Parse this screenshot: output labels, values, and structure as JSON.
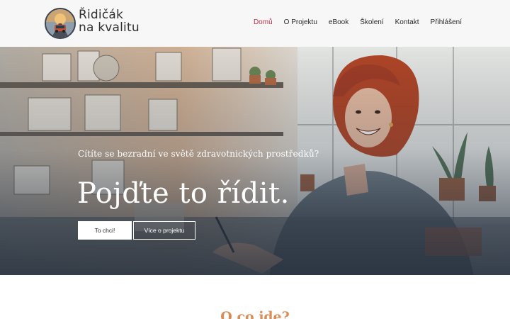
{
  "brand": {
    "line1": "Řidičák",
    "line2": "na kvalitu",
    "logo_icon": "car-road-logo-icon"
  },
  "nav": {
    "items": [
      {
        "label": "Domů",
        "active": true
      },
      {
        "label": "O Projektu",
        "active": false
      },
      {
        "label": "eBook",
        "active": false
      },
      {
        "label": "Školení",
        "active": false
      },
      {
        "label": "Kontakt",
        "active": false
      },
      {
        "label": "Přihlášení",
        "active": false
      }
    ]
  },
  "hero": {
    "subtitle": "Cítíte se bezradní ve světě zdravotnických prostředků?",
    "title": "Pojďte to řídit.",
    "primary_button": "To chci!",
    "secondary_button": "Více o projektu"
  },
  "section": {
    "title": "O co jde?"
  },
  "colors": {
    "accent": "#c0304a",
    "section_title": "#d98d58",
    "header_bg": "#f7f7f7"
  }
}
